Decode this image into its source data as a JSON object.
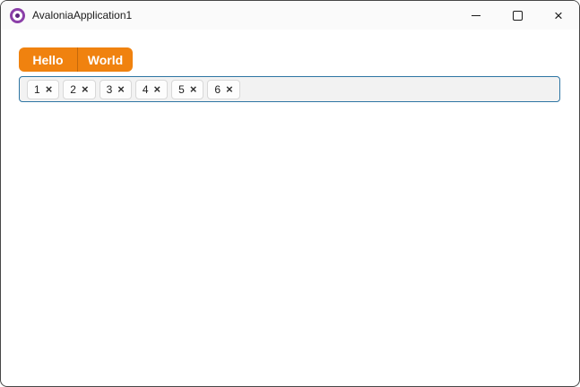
{
  "window": {
    "title": "AvaloniaApplication1",
    "logo_icon": "avalonia-logo",
    "controls": {
      "minimize_icon": "minimize",
      "maximize_icon": "maximize",
      "close_icon": "close",
      "close_glyph": "×"
    }
  },
  "toolbar": {
    "buttons": [
      {
        "label": "Hello"
      },
      {
        "label": "World"
      }
    ]
  },
  "tag_input": {
    "chips": [
      {
        "label": "1",
        "remove_glyph": "×"
      },
      {
        "label": "2",
        "remove_glyph": "×"
      },
      {
        "label": "3",
        "remove_glyph": "×"
      },
      {
        "label": "4",
        "remove_glyph": "×"
      },
      {
        "label": "5",
        "remove_glyph": "×"
      },
      {
        "label": "6",
        "remove_glyph": "×"
      }
    ]
  },
  "colors": {
    "accent_orange": "#F0820F",
    "focus_border_blue": "#2E75A3",
    "logo_purple": "#8B3FA8",
    "titlebar_bg": "#FAFAFA",
    "chipbox_bg": "#F2F2F2"
  }
}
